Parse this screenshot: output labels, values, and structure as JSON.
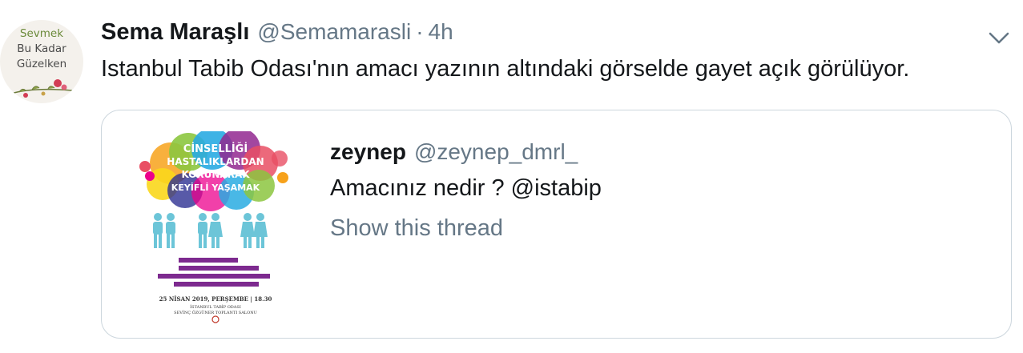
{
  "tweet": {
    "avatar_lines": [
      "Sevmek",
      "Bu Kadar",
      "Güzelken"
    ],
    "display_name": "Sema Maraşlı",
    "handle": "@Semamarasli",
    "separator": "·",
    "time": "4h",
    "text": "Istanbul Tabib Odası'nın amacı yazının altındaki görselde gayet açık görülüyor.",
    "menu_icon": "chevron-down-icon"
  },
  "quoted_tweet": {
    "display_name": "zeynep",
    "handle": "@zeynep_dmrl_",
    "text": "Amacınız nedir ? @istabip",
    "thread_link": "Show this thread",
    "poster": {
      "headline": [
        "CİNSELLİĞİ",
        "HASTALIKLARDAN",
        "KORUNARAK",
        "KEYİFLİ YAŞAMAK"
      ],
      "date_line": "25 NİSAN 2019, PERŞEMBE | 18.30",
      "venue_lines": [
        "İSTANBUL TABİP ODASI",
        "SEVİNÇ ÖZGÜNER TOPLANTI SALONU"
      ],
      "bubble_colors": [
        "#e94f64",
        "#f7a21b",
        "#f9d71c",
        "#8cc63f",
        "#29abe2",
        "#2e3192",
        "#92278f",
        "#ec008c"
      ],
      "figure_color": "#6cc5d8",
      "bar_color": "#7d2a8f"
    }
  }
}
